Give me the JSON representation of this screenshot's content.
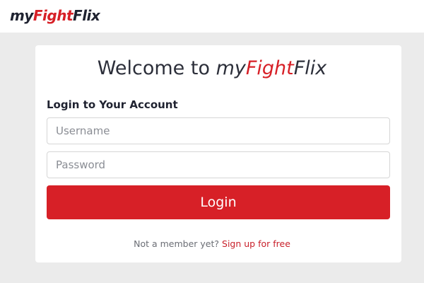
{
  "header": {
    "brand": {
      "part1": "my",
      "part2": "Fight",
      "part3": "Flix"
    }
  },
  "login": {
    "welcome_prefix": "Welcome to",
    "brand": {
      "part1": "my",
      "part2": "Fight",
      "part3": "Flix"
    },
    "subtitle": "Login to Your Account",
    "username_placeholder": "Username",
    "password_placeholder": "Password",
    "username_value": "",
    "password_value": "",
    "login_label": "Login",
    "signup_prompt": "Not a member yet?",
    "signup_link": "Sign up for free"
  },
  "colors": {
    "accent": "#d72027",
    "background": "#ebebeb",
    "card": "#ffffff",
    "text_dark": "#1f2230"
  }
}
